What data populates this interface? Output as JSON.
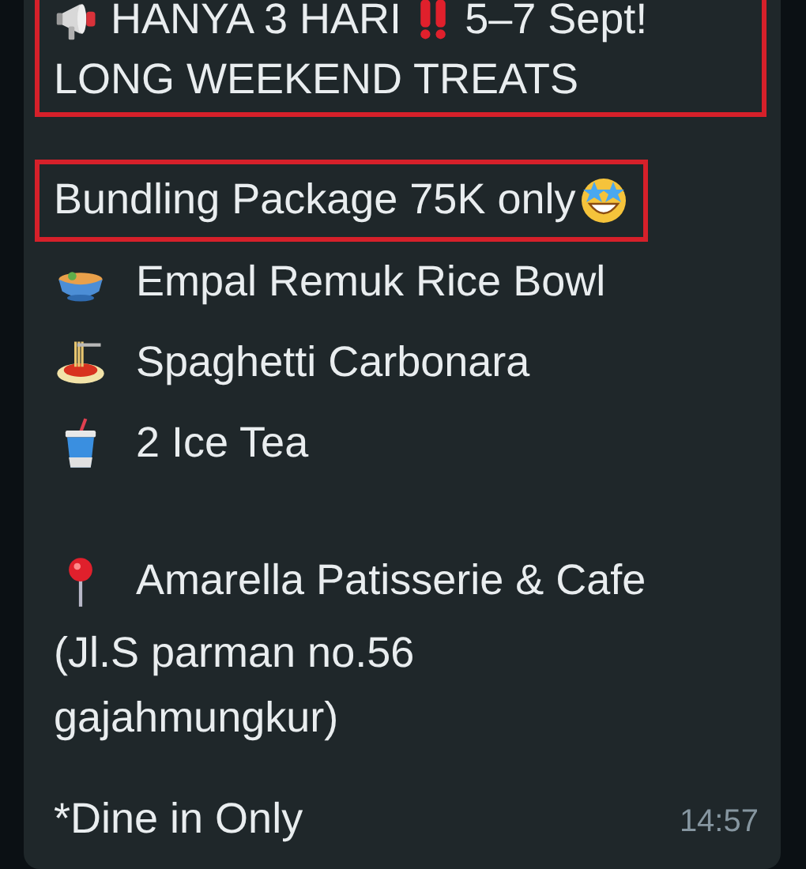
{
  "message": {
    "header_box": {
      "headline": "HANYA 3 HARI",
      "dates": "5–7 Sept!",
      "subline": "LONG WEEKEND TREATS"
    },
    "package_box": {
      "text": "Bundling Package 75K only"
    },
    "items": [
      {
        "kind": "bowl",
        "text": "Empal Remuk Rice Bowl"
      },
      {
        "kind": "spaghetti",
        "text": "Spaghetti Carbonara"
      },
      {
        "kind": "drink",
        "text": "2 Ice Tea"
      }
    ],
    "location": {
      "name": "Amarella Patisserie & Cafe",
      "address_lines": [
        "(Jl.S parman no.56",
        "gajahmungkur)"
      ]
    },
    "note": "*Dine in Only",
    "time": "14:57"
  }
}
